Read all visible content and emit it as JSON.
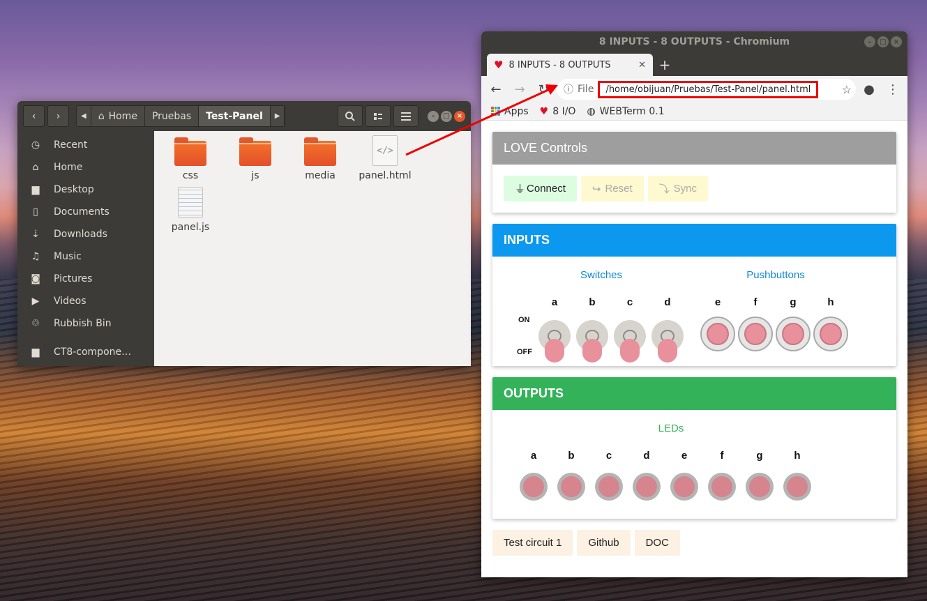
{
  "file_manager": {
    "breadcrumb": [
      "Home",
      "Pruebas",
      "Test-Panel"
    ],
    "sidebar": [
      {
        "label": "Recent",
        "icon": "clock-icon"
      },
      {
        "label": "Home",
        "icon": "home-icon"
      },
      {
        "label": "Desktop",
        "icon": "folder-icon"
      },
      {
        "label": "Documents",
        "icon": "document-icon"
      },
      {
        "label": "Downloads",
        "icon": "download-icon"
      },
      {
        "label": "Music",
        "icon": "music-icon"
      },
      {
        "label": "Pictures",
        "icon": "camera-icon"
      },
      {
        "label": "Videos",
        "icon": "video-icon"
      },
      {
        "label": "Rubbish Bin",
        "icon": "trash-icon"
      },
      {
        "label": "CT8-compone…",
        "icon": "drive-icon"
      }
    ],
    "files": [
      "css",
      "js",
      "media",
      "panel.html",
      "panel.js"
    ]
  },
  "browser": {
    "window_title": "8 INPUTS - 8 OUTPUTS - Chromium",
    "tab_title": "8 INPUTS - 8 OUTPUTS",
    "omnibox_prefix": "File",
    "url": "/home/obijuan/Pruebas/Test-Panel/panel.html",
    "bookmarks": [
      "Apps",
      "8 I/O",
      "WEBTerm 0.1"
    ]
  },
  "page": {
    "love": {
      "title": "LOVE Controls",
      "connect": "Connect",
      "reset": "Reset",
      "sync": "Sync"
    },
    "inputs": {
      "title": "INPUTS",
      "switches_title": "Switches",
      "pushbuttons_title": "Pushbuttons",
      "on_label": "ON",
      "off_label": "OFF",
      "switch_letters": [
        "a",
        "b",
        "c",
        "d"
      ],
      "pushbutton_letters": [
        "e",
        "f",
        "g",
        "h"
      ]
    },
    "outputs": {
      "title": "OUTPUTS",
      "leds_title": "LEDs",
      "led_letters": [
        "a",
        "b",
        "c",
        "d",
        "e",
        "f",
        "g",
        "h"
      ]
    },
    "footer": [
      "Test circuit 1",
      "Github",
      "DOC"
    ]
  }
}
